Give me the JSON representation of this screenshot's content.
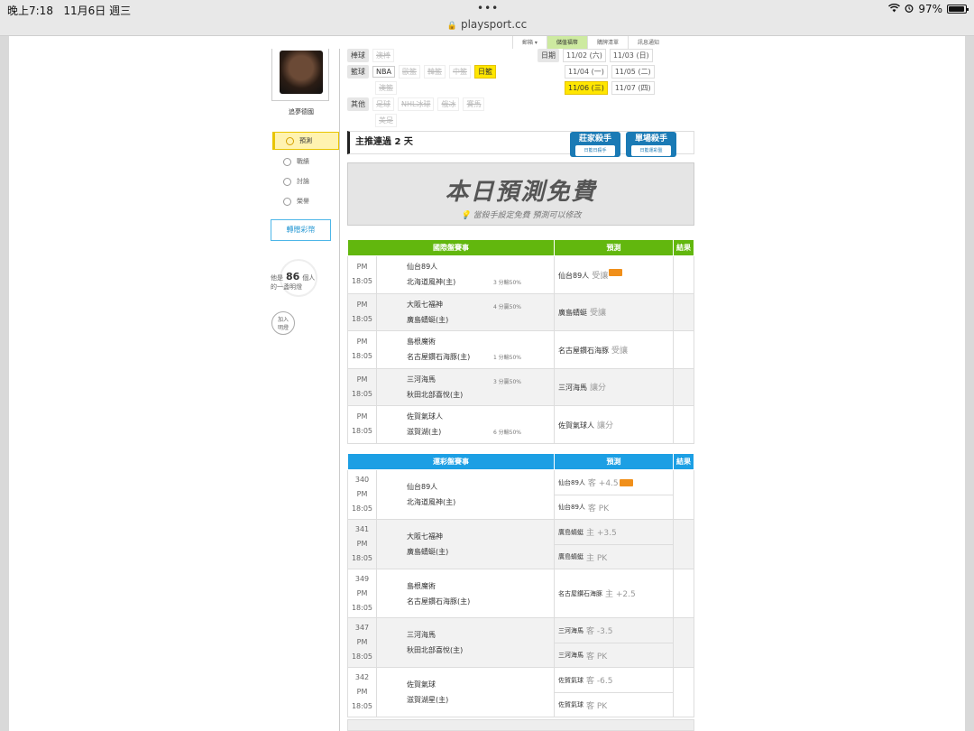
{
  "status_bar": {
    "time": "晚上7:18",
    "date": "11月6日 週三",
    "battery": "97%"
  },
  "browser": {
    "dots": "•••",
    "url": "playsport.cc"
  },
  "header_nav": [
    "郵箱 ▾",
    "儲值福幣",
    "購牌清單",
    "訊息通知"
  ],
  "profile": {
    "username": "追夢德國"
  },
  "sidebar": {
    "items": [
      {
        "label": "預測"
      },
      {
        "label": "戰績"
      },
      {
        "label": "討論"
      },
      {
        "label": "榮譽"
      }
    ],
    "transfer_button": "轉贈彩幣"
  },
  "fans": {
    "prefix": "他是",
    "count": "86",
    "suffix": "個人",
    "line2": "的一盞明燈",
    "join_line1": "加入",
    "join_line2": "明燈"
  },
  "filters": {
    "baseball": {
      "label": "棒球",
      "options": [
        "澳棒"
      ]
    },
    "basketball": {
      "label": "籃球",
      "options": [
        "NBA",
        "歐籃",
        "韓籃",
        "中籃",
        "日籃",
        "澳籃"
      ]
    },
    "other": {
      "label": "其他",
      "options": [
        "足球",
        "NHL冰球",
        "俄冰",
        "賽馬",
        "美足"
      ]
    }
  },
  "dates": {
    "label": "日期",
    "options": [
      "11/02 (六)",
      "11/03 (日)",
      "11/04 (一)",
      "11/05 (二)",
      "11/06 (三)",
      "11/07 (四)"
    ]
  },
  "streak": {
    "text": "主推連過 2 天"
  },
  "killers": [
    {
      "title": "莊家殺手",
      "sub": "日籃日殺手"
    },
    {
      "title": "單場殺手",
      "sub": "日籃運彩盤"
    }
  ],
  "free": {
    "title": "本日預測免費",
    "subtitle": "當殺手設定免費 預測可以修改"
  },
  "intl_table": {
    "headers": [
      "國際盤賽事",
      "預測",
      "結果"
    ],
    "rows": [
      {
        "period": "PM",
        "time": "18:05",
        "team1": "仙台89人",
        "team2": "北海道風神(主)",
        "odds": "3 分輸50%",
        "pred_team": "仙台89人",
        "pred_note": "受讓",
        "badge": true
      },
      {
        "period": "PM",
        "time": "18:05",
        "team1": "大阪七福神",
        "team2": "廣島蜻蜓(主)",
        "odds": "4 分贏50%",
        "pred_team": "廣島蜻蜓",
        "pred_note": "受讓",
        "badge": false
      },
      {
        "period": "PM",
        "time": "18:05",
        "team1": "島根魔術",
        "team2": "名古屋鑽石海豚(主)",
        "odds": "1 分輸50%",
        "pred_team": "名古屋鑽石海豚",
        "pred_note": "受讓",
        "badge": false
      },
      {
        "period": "PM",
        "time": "18:05",
        "team1": "三河海馬",
        "team2": "秋田北部喜悅(主)",
        "odds": "3 分贏50%",
        "pred_team": "三河海馬",
        "pred_note": "讓分",
        "badge": false
      },
      {
        "period": "PM",
        "time": "18:05",
        "team1": "佐賀氣球人",
        "team2": "滋賀湖(主)",
        "odds": "6 分輸50%",
        "pred_team": "佐賀氣球人",
        "pred_note": "讓分",
        "badge": false
      }
    ]
  },
  "lottery_table": {
    "headers": [
      "運彩盤賽事",
      "預測",
      "結果"
    ],
    "rows": [
      {
        "num": "340",
        "period": "PM",
        "time": "18:05",
        "team1": "仙台89人",
        "team2": "北海道風神(主)",
        "preds": [
          {
            "team": "仙台89人",
            "note": "客 +4.5",
            "badge": true
          },
          {
            "team": "仙台89人",
            "note": "客 PK",
            "badge": false
          }
        ]
      },
      {
        "num": "341",
        "period": "PM",
        "time": "18:05",
        "team1": "大阪七福神",
        "team2": "廣島蜻蜓(主)",
        "preds": [
          {
            "team": "廣島蜻蜓",
            "note": "主 +3.5",
            "badge": false
          },
          {
            "team": "廣島蜻蜓",
            "note": "主 PK",
            "badge": false
          }
        ]
      },
      {
        "num": "349",
        "period": "PM",
        "time": "18:05",
        "team1": "島根魔術",
        "team2": "名古屋鑽石海豚(主)",
        "preds": [
          {
            "team": "名古屋鑽石海豚",
            "note": "主 +2.5",
            "badge": false
          }
        ]
      },
      {
        "num": "347",
        "period": "PM",
        "time": "18:05",
        "team1": "三河海馬",
        "team2": "秋田北部喜悅(主)",
        "preds": [
          {
            "team": "三河海馬",
            "note": "客 -3.5",
            "badge": false
          },
          {
            "team": "三河海馬",
            "note": "客 PK",
            "badge": false
          }
        ]
      },
      {
        "num": "342",
        "period": "PM",
        "time": "18:05",
        "team1": "佐賀氣球",
        "team2": "滋賀湖星(主)",
        "preds": [
          {
            "team": "佐賀氣球",
            "note": "客 -6.5",
            "badge": false
          },
          {
            "team": "佐賀氣球",
            "note": "客 PK",
            "badge": false
          }
        ]
      }
    ]
  },
  "colors": {
    "green_header": "#62b70e",
    "blue_header": "#1c9fe4",
    "selected": "#ffe600",
    "badge": "#f08f1a"
  }
}
